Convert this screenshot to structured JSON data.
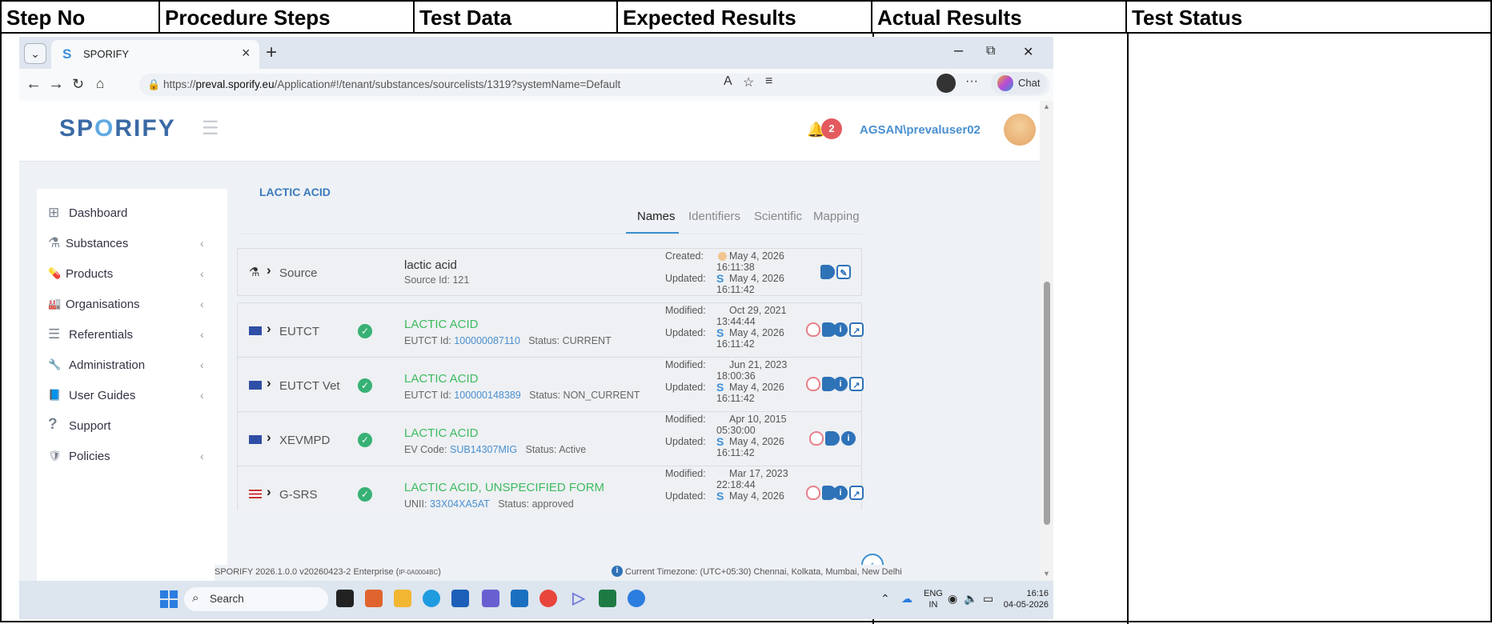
{
  "doc_headers": [
    "Step No",
    "Procedure Steps",
    "Test Data",
    "Expected Results",
    "Actual Results",
    "Test Status"
  ],
  "browser": {
    "tab_title": "SPORIFY",
    "tab_close": "×",
    "new_tab": "+",
    "win_minimize": "–",
    "win_restore": "⧉",
    "win_close": "✕",
    "url_prefix": "https://",
    "url_domain": "preval.sporify.eu",
    "url_path": "/Application#!/tenant/substances/sourcelists/1319?systemName=Default",
    "chat_label": "Chat"
  },
  "app": {
    "brand_left": "SP",
    "brand_o": "O",
    "brand_right": "RIFY",
    "notification_count": "2",
    "user": "AGSAN\\prevaluser02"
  },
  "sidebar": {
    "items": [
      {
        "label": "Dashboard",
        "icon": "grid-icon",
        "glyph": "⊞"
      },
      {
        "label": "Substances",
        "icon": "flask-icon",
        "glyph": "⚗"
      },
      {
        "label": "Products",
        "icon": "pills-icon",
        "glyph": "💊"
      },
      {
        "label": "Organisations",
        "icon": "factory-icon",
        "glyph": "🏭"
      },
      {
        "label": "Referentials",
        "icon": "list-icon",
        "glyph": "☰"
      },
      {
        "label": "Administration",
        "icon": "wrench-icon",
        "glyph": "🔧"
      },
      {
        "label": "User Guides",
        "icon": "book-icon",
        "glyph": "📘"
      },
      {
        "label": "Support",
        "icon": "question-icon",
        "glyph": "?"
      },
      {
        "label": "Policies",
        "icon": "shield-icon",
        "glyph": "🛡"
      }
    ],
    "arrow": "‹"
  },
  "content": {
    "title": "LACTIC ACID",
    "tabs": [
      "Names",
      "Identifiers",
      "Scientific",
      "Mapping"
    ],
    "active_tab": "Names"
  },
  "rows": [
    {
      "source": "Source",
      "name": "lactic acid",
      "sub_label": "Source Id: 121",
      "sub_id": "",
      "status": "",
      "meta1_label": "Created:",
      "meta1_date": "May 4, 2026",
      "meta1_time": "16:11:38",
      "meta2_label": "Updated:",
      "meta2_date": "May 4, 2026",
      "meta2_time": "16:11:42"
    },
    {
      "source": "EUTCT",
      "name": "LACTIC ACID",
      "sub_label": "EUTCT Id:",
      "sub_id": "100000087110",
      "status": "Status: CURRENT",
      "meta1_label": "Modified:",
      "meta1_date": "Oct 29, 2021",
      "meta1_time": "13:44:44",
      "meta2_label": "Updated:",
      "meta2_date": "May 4, 2026",
      "meta2_time": "16:11:42"
    },
    {
      "source": "EUTCT Vet",
      "name": "LACTIC ACID",
      "sub_label": "EUTCT Id:",
      "sub_id": "100000148389",
      "status": "Status: NON_CURRENT",
      "meta1_label": "Modified:",
      "meta1_date": "Jun 21, 2023",
      "meta1_time": "18:00:36",
      "meta2_label": "Updated:",
      "meta2_date": "May 4, 2026",
      "meta2_time": "16:11:42"
    },
    {
      "source": "XEVMPD",
      "name": "LACTIC ACID",
      "sub_label": "EV Code:",
      "sub_id": "SUB14307MIG",
      "status": "Status: Active",
      "meta1_label": "Modified:",
      "meta1_date": "Apr 10, 2015",
      "meta1_time": "05:30:00",
      "meta2_label": "Updated:",
      "meta2_date": "May 4, 2026",
      "meta2_time": "16:11:42"
    },
    {
      "source": "G-SRS",
      "name": "LACTIC ACID, UNSPECIFIED FORM",
      "sub_label": "UNII:",
      "sub_id": "33X04XA5AT",
      "status": "Status: approved",
      "meta1_label": "Modified:",
      "meta1_date": "Mar 17, 2023",
      "meta1_time": "22:18:44",
      "meta2_label": "Updated:",
      "meta2_date": "May 4, 2026",
      "meta2_time": ""
    }
  ],
  "footer": {
    "version": "SPORIFY 2026.1.0.0 v20260423-2 Enterprise (",
    "version_code": "IP-0A0004BC",
    "version_end": ")",
    "timezone": "Current Timezone: (UTC+05:30) Chennai, Kolkata, Mumbai, New Delhi"
  },
  "taskbar": {
    "search": "Search",
    "lang_top": "ENG",
    "lang_bottom": "IN",
    "time": "16:16",
    "date": "04-05-2026"
  },
  "colors": {
    "accent": "#3a8fd1",
    "green": "#3dbb5f",
    "badge": "#e35a5f"
  }
}
